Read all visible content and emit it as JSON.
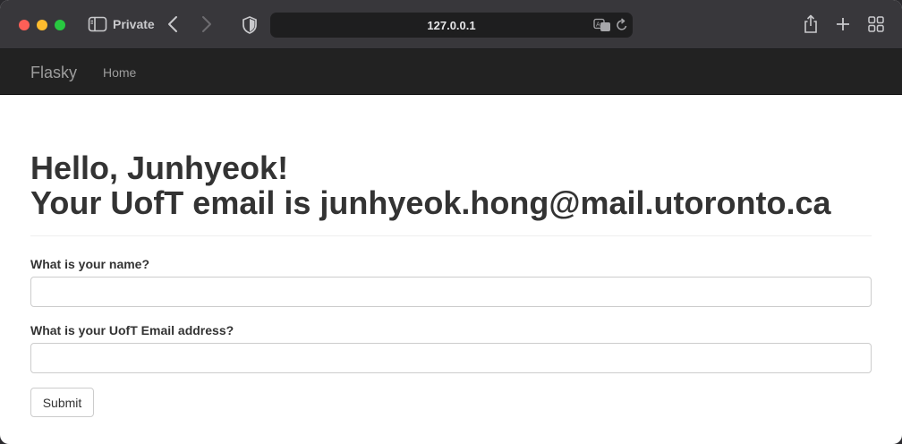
{
  "browser": {
    "private_label": "Private",
    "url": "127.0.0.1",
    "icons": [
      "sidebar-icon",
      "back-icon",
      "forward-icon",
      "shield-icon",
      "translate-icon",
      "reload-icon",
      "share-icon",
      "plus-icon",
      "tab-overview-icon"
    ]
  },
  "navbar": {
    "brand": "Flasky",
    "links": [
      {
        "label": "Home"
      }
    ]
  },
  "main": {
    "greeting": "Hello, Junhyeok!",
    "email_line": "Your UofT email is junhyeok.hong@mail.utoronto.ca"
  },
  "form": {
    "name_label": "What is your name?",
    "name_value": "",
    "email_label": "What is your UofT Email address?",
    "email_value": "",
    "submit_label": "Submit"
  },
  "colors": {
    "toolbar": "#38373b",
    "navbar": "#222222",
    "text": "#333333",
    "nav_text": "#9d9d9d"
  }
}
